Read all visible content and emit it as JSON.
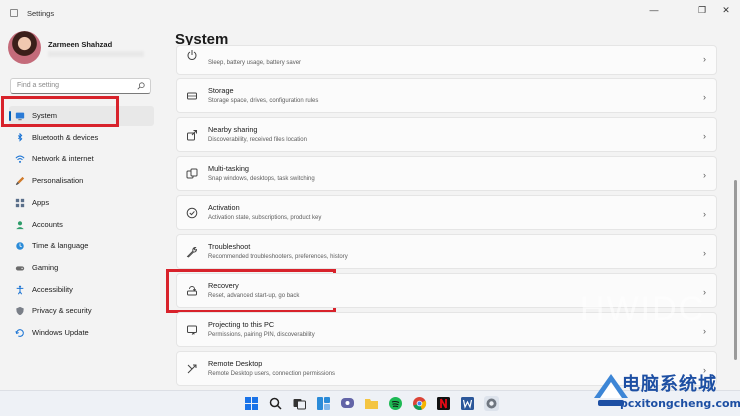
{
  "window": {
    "title": "Settings",
    "minimize_glyph": "—",
    "maximize_glyph": "❐",
    "close_glyph": "✕"
  },
  "profile": {
    "name": "Zarmeen Shahzad"
  },
  "search": {
    "placeholder": "Find a setting"
  },
  "sidebar": {
    "items": [
      {
        "label": "System",
        "icon": "monitor-icon",
        "active": true
      },
      {
        "label": "Bluetooth & devices",
        "icon": "bluetooth-icon"
      },
      {
        "label": "Network & internet",
        "icon": "wifi-icon"
      },
      {
        "label": "Personalisation",
        "icon": "brush-icon"
      },
      {
        "label": "Apps",
        "icon": "apps-icon"
      },
      {
        "label": "Accounts",
        "icon": "account-icon"
      },
      {
        "label": "Time & language",
        "icon": "globe-clock-icon"
      },
      {
        "label": "Gaming",
        "icon": "gamepad-icon"
      },
      {
        "label": "Accessibility",
        "icon": "accessibility-icon"
      },
      {
        "label": "Privacy & security",
        "icon": "shield-icon"
      },
      {
        "label": "Windows Update",
        "icon": "update-icon"
      }
    ]
  },
  "main": {
    "title": "System",
    "cards": [
      {
        "title": "",
        "subtitle": "Sleep, battery usage, battery saver",
        "icon": "power-icon"
      },
      {
        "title": "Storage",
        "subtitle": "Storage space, drives, configuration rules",
        "icon": "storage-icon"
      },
      {
        "title": "Nearby sharing",
        "subtitle": "Discoverability, received files location",
        "icon": "share-icon"
      },
      {
        "title": "Multi-tasking",
        "subtitle": "Snap windows, desktops, task switching",
        "icon": "multitask-icon"
      },
      {
        "title": "Activation",
        "subtitle": "Activation state, subscriptions, product key",
        "icon": "check-circle-icon"
      },
      {
        "title": "Troubleshoot",
        "subtitle": "Recommended troubleshooters, preferences, history",
        "icon": "wrench-icon"
      },
      {
        "title": "Recovery",
        "subtitle": "Reset, advanced start-up, go back",
        "icon": "recovery-icon"
      },
      {
        "title": "Projecting to this PC",
        "subtitle": "Permissions, pairing PIN, discoverability",
        "icon": "projector-icon"
      },
      {
        "title": "Remote Desktop",
        "subtitle": "Remote Desktop users, connection permissions",
        "icon": "remote-desktop-icon"
      }
    ]
  },
  "watermark": "HWIDC",
  "brand": {
    "chinese": "电脑系统城",
    "url": "pcxitongcheng.com"
  },
  "taskbar": {
    "icons": [
      "windows-start-icon",
      "search-icon",
      "task-view-icon",
      "widgets-icon",
      "chat-icon",
      "file-explorer-icon",
      "spotify-icon",
      "chrome-icon",
      "netflix-icon",
      "word-icon",
      "settings-icon"
    ]
  },
  "colors": {
    "accent": "#005fb8",
    "highlight_box": "#d8222b",
    "brand": "#1d4fa3"
  }
}
